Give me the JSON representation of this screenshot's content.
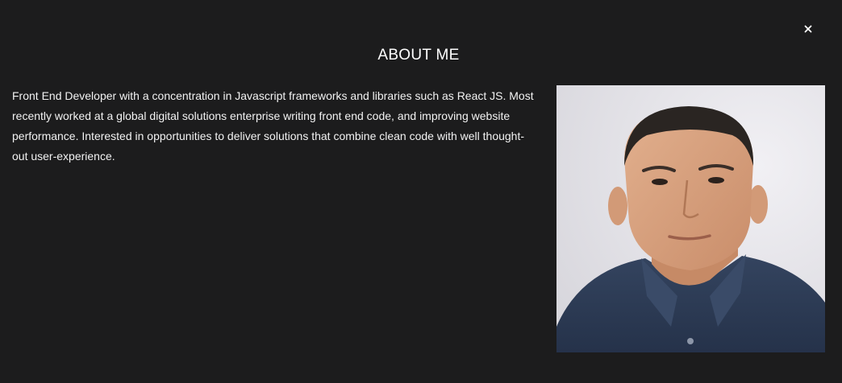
{
  "modal": {
    "close_icon": "close-icon",
    "title": "ABOUT ME",
    "bio": "Front End Developer with a concentration in Javascript frameworks and libraries such as React JS. Most recently worked at a global digital solutions enterprise writing front end code, and improving website performance. Interested in opportunities to deliver solutions that combine clean code with well thought-out user-experience.",
    "photo_icon": "profile-photo"
  },
  "colors": {
    "background": "#1c1c1d",
    "text": "#ffffff",
    "photo_background": "#e6e5ea",
    "shirt": "#2c3b55"
  }
}
